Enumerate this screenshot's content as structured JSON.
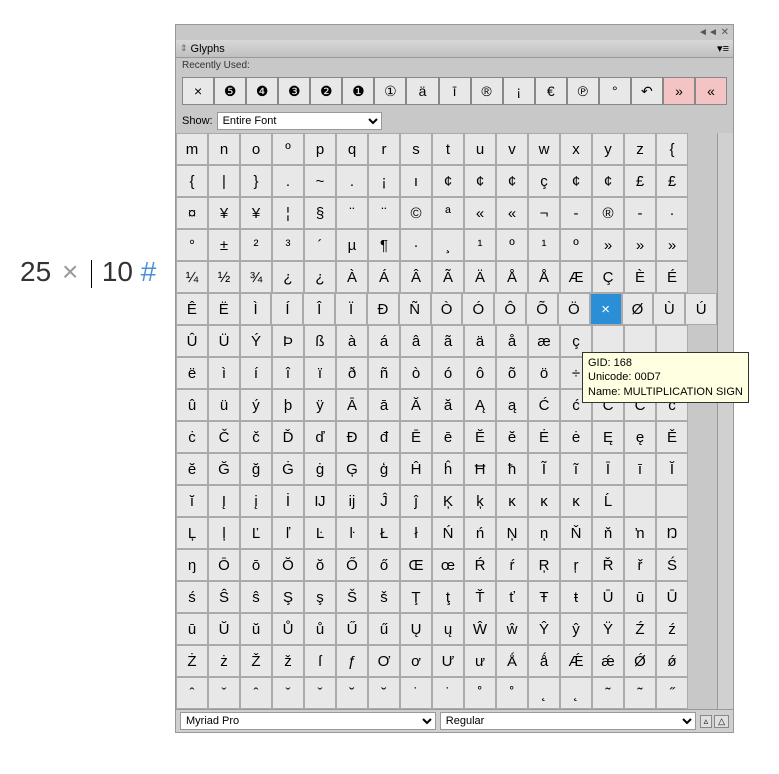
{
  "expression": {
    "a": "25",
    "op": "×",
    "b": "10",
    "tag": "#"
  },
  "panel_title": "Glyphs",
  "recent_label": "Recently Used:",
  "recent": [
    "×",
    "❺",
    "❹",
    "❸",
    "❷",
    "❶",
    "①",
    "ä",
    "ī",
    "®",
    "¡",
    "€",
    "℗",
    "°",
    "↶",
    "»",
    "«"
  ],
  "show_label": "Show:",
  "show_value": "Entire Font",
  "footer": {
    "font": "Myriad Pro",
    "style": "Regular"
  },
  "tooltip": {
    "gid": "GID: 168",
    "uni": "Unicode: 00D7",
    "name": "Name: MULTIPLICATION SIGN"
  },
  "selected_glyph": "×",
  "grid": [
    [
      "m",
      "n",
      "o",
      "º",
      "p",
      "q",
      "r",
      "s",
      "t",
      "u",
      "v",
      "w",
      "x",
      "y",
      "z",
      "{"
    ],
    [
      "{",
      "|",
      "}",
      ".",
      "~",
      ".",
      "¡",
      "ı",
      "¢",
      "¢",
      "¢",
      "ç",
      "¢",
      "¢",
      "£",
      "£"
    ],
    [
      "¤",
      "¥",
      "¥",
      "¦",
      "§",
      "¨",
      "¨",
      "©",
      "ª",
      "«",
      "«",
      "¬",
      "-",
      "®",
      "-",
      "·"
    ],
    [
      "°",
      "±",
      "²",
      "³",
      "´",
      "µ",
      "¶",
      "·",
      "¸",
      "¹",
      "º",
      "¹",
      "º",
      "»",
      "»",
      "»"
    ],
    [
      "¼",
      "½",
      "¾",
      "¿",
      "¿",
      "À",
      "Á",
      "Â",
      "Ã",
      "Ä",
      "Å",
      "Å",
      "Æ",
      "Ç",
      "È",
      "É"
    ],
    [
      "Ê",
      "Ë",
      "Ì",
      "Í",
      "Î",
      "Ï",
      "Ð",
      "Ñ",
      "Ò",
      "Ó",
      "Ô",
      "Õ",
      "Ö",
      "×",
      "Ø",
      "Ù",
      "Ú"
    ],
    [
      "Û",
      "Ü",
      "Ý",
      "Þ",
      "ß",
      "à",
      "á",
      "â",
      "ã",
      "ä",
      "å",
      "æ",
      "ç",
      "",
      "",
      ""
    ],
    [
      "ë",
      "ì",
      "í",
      "î",
      "ï",
      "ð",
      "ñ",
      "ò",
      "ó",
      "ô",
      "õ",
      "ö",
      "÷",
      "",
      "",
      ""
    ],
    [
      "û",
      "ü",
      "ý",
      "þ",
      "ÿ",
      "Ā",
      "ā",
      "Ă",
      "ă",
      "Ą",
      "ą",
      "Ć",
      "ć",
      "Ĉ",
      "Ĉ",
      "ĉ"
    ],
    [
      "ċ",
      "Č",
      "č",
      "Ď",
      "ď",
      "Đ",
      "đ",
      "Ē",
      "ē",
      "Ĕ",
      "ĕ",
      "Ė",
      "ė",
      "Ę",
      "ę",
      "Ě"
    ],
    [
      "ĕ",
      "Ğ",
      "ğ",
      "Ġ",
      "ġ",
      "Ģ",
      "ģ",
      "Ĥ",
      "ĥ",
      "Ħ",
      "ħ",
      "Ĩ",
      "ĩ",
      "Ī",
      "ī",
      "Ĭ"
    ],
    [
      "ĭ",
      "Į",
      "į",
      "İ",
      "Ĳ",
      "ĳ",
      "Ĵ",
      "ĵ",
      "Ķ",
      "ķ",
      "ĸ",
      "ĸ",
      "ĸ",
      "Ĺ",
      "",
      ""
    ],
    [
      "Ļ",
      "ļ",
      "Ľ",
      "ľ",
      "Ŀ",
      "ŀ",
      "Ł",
      "ł",
      "Ń",
      "ń",
      "Ņ",
      "ņ",
      "Ň",
      "ň",
      "ŉ",
      "Ŋ"
    ],
    [
      "ŋ",
      "Ō",
      "ō",
      "Ŏ",
      "ŏ",
      "Ő",
      "ő",
      "Œ",
      "œ",
      "Ŕ",
      "ŕ",
      "Ŗ",
      "ŗ",
      "Ř",
      "ř",
      "Ś"
    ],
    [
      "ś",
      "Ŝ",
      "ŝ",
      "Ş",
      "ş",
      "Š",
      "š",
      "Ţ",
      "ţ",
      "Ť",
      "ť",
      "Ŧ",
      "ŧ",
      "Ū",
      "ū",
      "Ū"
    ],
    [
      "ū",
      "Ŭ",
      "ŭ",
      "Ů",
      "ů",
      "Ű",
      "ű",
      "Ų",
      "ų",
      "Ŵ",
      "ŵ",
      "Ŷ",
      "ŷ",
      "Ÿ",
      "Ź",
      "ź"
    ],
    [
      "Ż",
      "ż",
      "Ž",
      "ž",
      "ſ",
      "ƒ",
      "Ơ",
      "ơ",
      "Ư",
      "ư",
      "Ǻ",
      "ǻ",
      "Ǽ",
      "ǽ",
      "Ǿ",
      "ǿ"
    ],
    [
      "ˆ",
      "ˇ",
      "ˆ",
      "ˇ",
      "ˇ",
      "˘",
      "˘",
      "˙",
      "˙",
      "˚",
      "˚",
      "˛",
      "˛",
      "˜",
      "˜",
      "˝"
    ]
  ]
}
